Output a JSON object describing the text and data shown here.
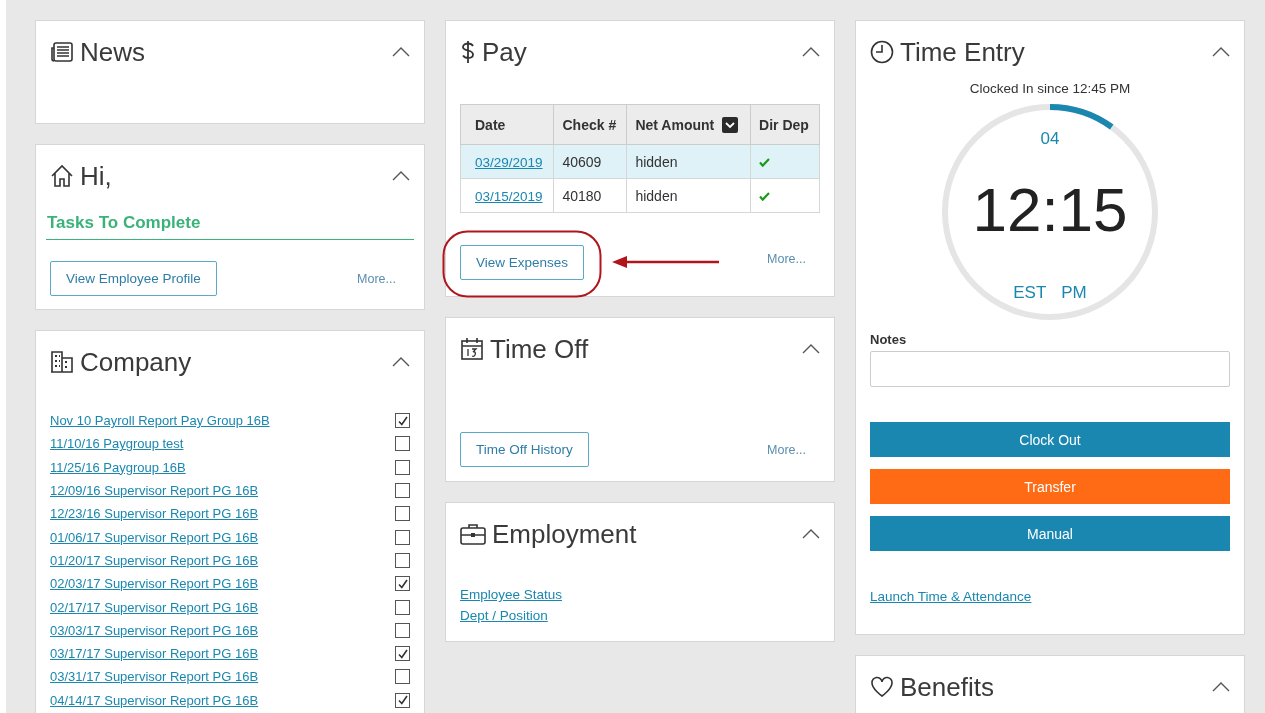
{
  "columns": [
    [
      {
        "kind": "news",
        "title": "News"
      },
      {
        "kind": "home",
        "title": "Hi,",
        "heading": "Tasks To Complete",
        "button": "View Employee Profile",
        "more": "More..."
      },
      {
        "kind": "company",
        "title": "Company",
        "items": [
          {
            "label": "Nov 10 Payroll Report Pay Group 16B",
            "checked": true
          },
          {
            "label": "11/10/16 Paygroup test",
            "checked": false
          },
          {
            "label": "11/25/16 Paygroup 16B",
            "checked": false
          },
          {
            "label": "12/09/16 Supervisor Report PG 16B",
            "checked": false
          },
          {
            "label": "12/23/16 Supervisor Report PG 16B",
            "checked": false
          },
          {
            "label": "01/06/17 Supervisor Report PG 16B",
            "checked": false
          },
          {
            "label": "01/20/17 Supervisor Report PG 16B",
            "checked": false
          },
          {
            "label": "02/03/17 Supervisor Report PG 16B",
            "checked": true
          },
          {
            "label": "02/17/17 Supervisor Report PG 16B",
            "checked": false
          },
          {
            "label": "03/03/17 Supervisor Report PG 16B",
            "checked": false
          },
          {
            "label": "03/17/17 Supervisor Report PG 16B",
            "checked": true
          },
          {
            "label": "03/31/17 Supervisor Report PG 16B",
            "checked": false
          },
          {
            "label": "04/14/17 Supervisor Report PG 16B",
            "checked": true
          }
        ]
      }
    ],
    [
      {
        "kind": "pay",
        "title": "Pay",
        "columns": [
          "Date",
          "Check #",
          "Net Amount",
          "Dir Dep"
        ],
        "rows": [
          {
            "date": "03/29/2019",
            "check": "40609",
            "net": "hidden",
            "direct_deposit": true,
            "selected": true
          },
          {
            "date": "03/15/2019",
            "check": "40180",
            "net": "hidden",
            "direct_deposit": true,
            "selected": false
          }
        ],
        "button": "View Expenses",
        "more": "More..."
      },
      {
        "kind": "time_off",
        "title": "Time Off",
        "button": "Time Off History",
        "more": "More..."
      },
      {
        "kind": "employment",
        "title": "Employment",
        "links": [
          "Employee Status",
          "Dept / Position"
        ]
      }
    ],
    [
      {
        "kind": "time_entry",
        "title": "Time Entry",
        "status": "Clocked In since 12:45 PM",
        "clock": {
          "seconds": "04",
          "time": "12:15",
          "zone": "EST",
          "meridiem": "PM"
        },
        "notes_label": "Notes",
        "buttons": [
          {
            "label": "Clock Out",
            "color": "#1a87b0"
          },
          {
            "label": "Transfer",
            "color": "#ff6a14"
          },
          {
            "label": "Manual",
            "color": "#1a87b0"
          }
        ],
        "link": "Launch Time & Attendance"
      },
      {
        "kind": "benefits",
        "title": "Benefits"
      }
    ]
  ]
}
